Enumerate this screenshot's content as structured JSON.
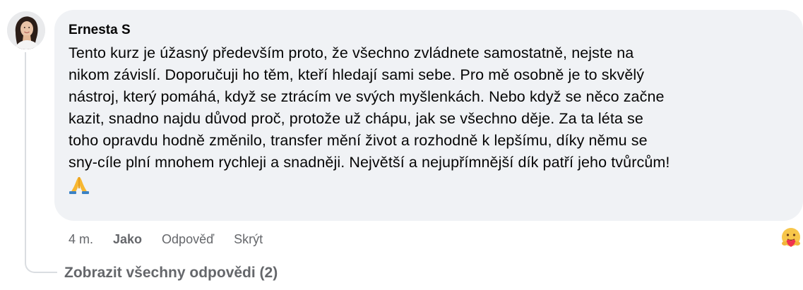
{
  "comment": {
    "author": "Ernesta S",
    "text": "Tento kurz je úžasný především proto, že všechno zvládnete samostatně, nejste na\nnikom závislí. Doporučuji ho těm, kteří hledají sami sebe. Pro mě osobně je to skvělý\nnástroj, který pomáhá, když se ztrácím ve svých myšlenkách. Nebo když se něco začne\nkazit, snadno najdu důvod proč, protože už chápu, jak se všechno děje. Za ta léta se\ntoho opravdu hodně změnilo, transfer mění život a rozhodně k lepšímu, díky němu se\nsny-cíle plní mnohem rychleji a snadněji. Největší a nejupřímnější dík patří jeho tvůrcům!",
    "emoji": "folded-hands-icon"
  },
  "actions": {
    "time": "4 m.",
    "like_label": "Jako",
    "reply_label": "Odpověď",
    "hide_label": "Skrýt",
    "reaction_icon": "care-reaction-icon"
  },
  "replies": {
    "view_all_label": "Zobrazit všechny odpovědi (2)"
  },
  "colors": {
    "bubble_bg": "#f0f2f5",
    "secondary_text": "#65676b",
    "primary_text": "#050505",
    "thread_line": "#dadde1"
  }
}
